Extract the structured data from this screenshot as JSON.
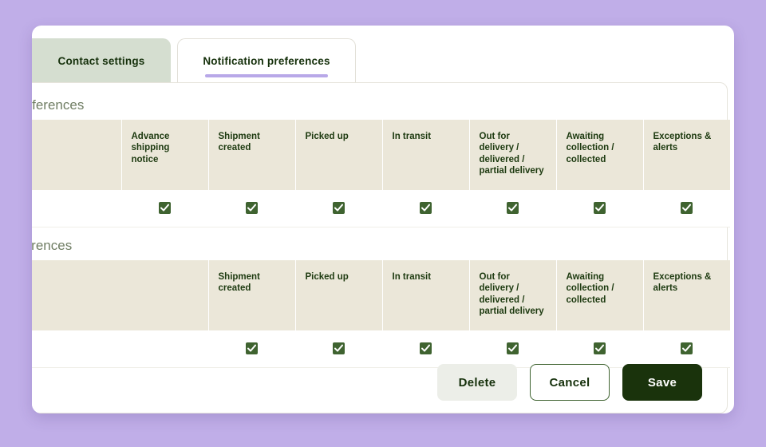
{
  "theme": {
    "background": "#c0aee8",
    "panel": "#ffffff",
    "tab_inactive": "#d5ded0",
    "tab_active_underline": "#b8a8e8",
    "table_header": "#ebe7d9",
    "checkbox": "#3f6330",
    "heading_text": "#6f7d63",
    "save_button": "#1a330c"
  },
  "tabs": [
    {
      "id": "contact-settings",
      "label": "Contact settings",
      "active": false
    },
    {
      "id": "notification-preferences",
      "label": "Notification preferences",
      "active": true
    }
  ],
  "sections": [
    {
      "id": "section-1",
      "title": "references",
      "columns": [
        "",
        "Advance shipping notice",
        "Shipment created",
        "Picked up",
        "In transit",
        "Out for delivery / delivered / partial delivery",
        "Awaiting collection / collected",
        "Exceptions & alerts"
      ],
      "rows": [
        {
          "label": "",
          "checks": [
            true,
            true,
            true,
            true,
            true,
            true,
            true
          ]
        }
      ]
    },
    {
      "id": "section-2",
      "title": "ferences",
      "columns": [
        "",
        "Shipment created",
        "Picked up",
        "In transit",
        "Out for delivery / delivered / partial delivery",
        "Awaiting collection / collected",
        "Exceptions & alerts"
      ],
      "rows": [
        {
          "label": "",
          "checks": [
            true,
            true,
            true,
            true,
            true,
            true
          ]
        }
      ]
    }
  ],
  "footer": {
    "delete_label": "Delete",
    "cancel_label": "Cancel",
    "save_label": "Save"
  }
}
